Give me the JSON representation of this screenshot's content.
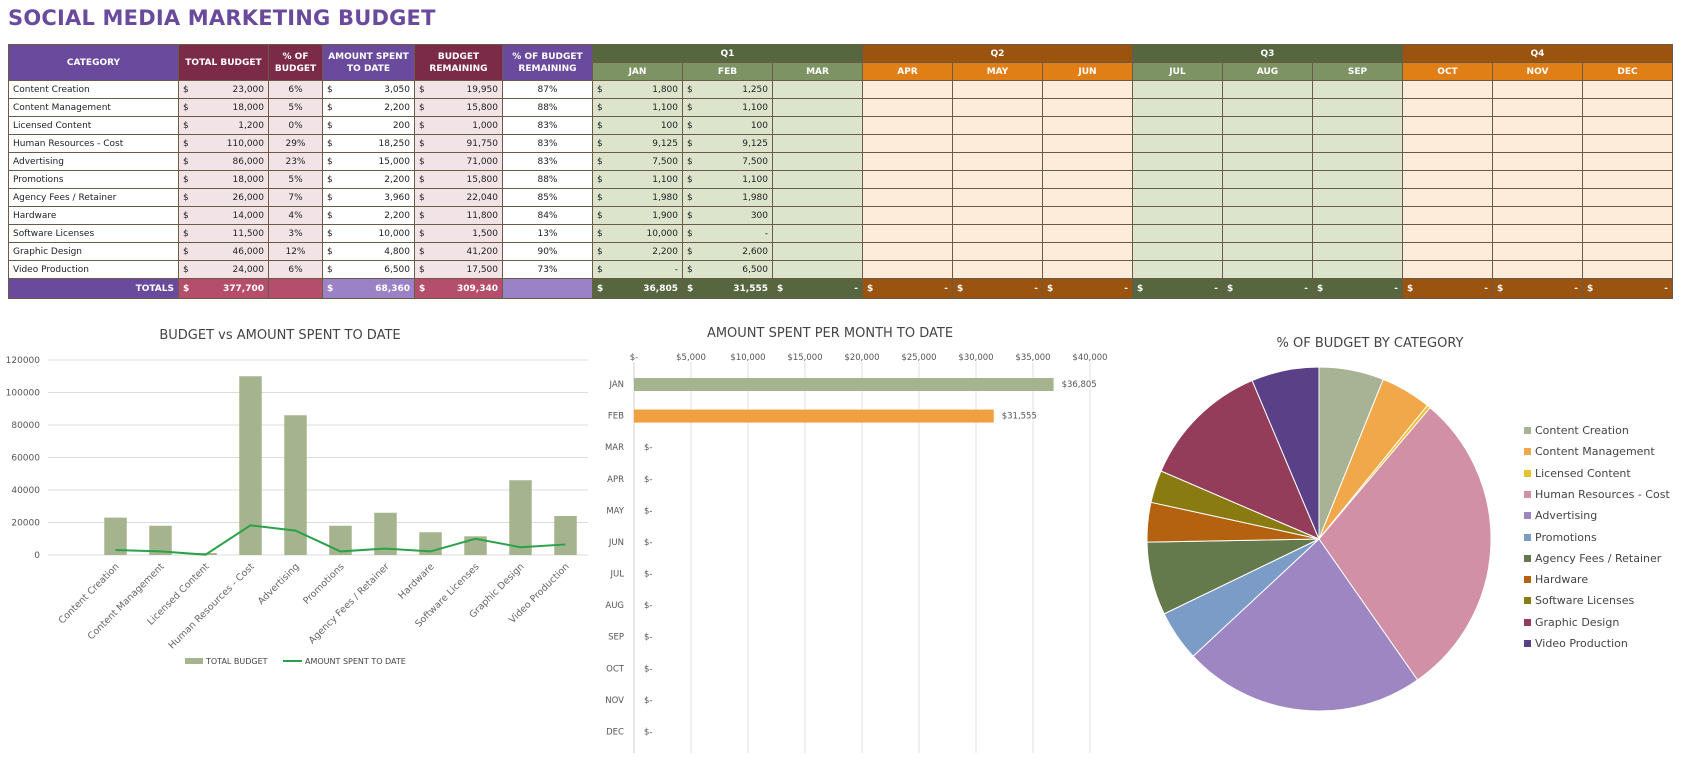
{
  "title": "SOCIAL MEDIA MARKETING BUDGET",
  "table": {
    "headers": {
      "category": "CATEGORY",
      "total_budget": "TOTAL BUDGET",
      "pct_budget_1": "% OF",
      "pct_budget_2": "BUDGET",
      "spent_1": "AMOUNT SPENT",
      "spent_2": "TO DATE",
      "remaining_1": "BUDGET",
      "remaining_2": "REMAINING",
      "pct_remaining_1": "% OF BUDGET",
      "pct_remaining_2": "REMAINING"
    },
    "quarters": [
      "Q1",
      "Q2",
      "Q3",
      "Q4"
    ],
    "months": [
      "JAN",
      "FEB",
      "MAR",
      "APR",
      "MAY",
      "JUN",
      "JUL",
      "AUG",
      "SEP",
      "OCT",
      "NOV",
      "DEC"
    ],
    "currency": "$",
    "rows": [
      {
        "category": "Content Creation",
        "total": "23,000",
        "pct": "6%",
        "spent": "3,050",
        "remaining": "19,950",
        "pct_remaining": "87%",
        "months": [
          "1,800",
          "1,250"
        ]
      },
      {
        "category": "Content Management",
        "total": "18,000",
        "pct": "5%",
        "spent": "2,200",
        "remaining": "15,800",
        "pct_remaining": "88%",
        "months": [
          "1,100",
          "1,100"
        ]
      },
      {
        "category": "Licensed Content",
        "total": "1,200",
        "pct": "0%",
        "spent": "200",
        "remaining": "1,000",
        "pct_remaining": "83%",
        "months": [
          "100",
          "100"
        ]
      },
      {
        "category": "Human Resources - Cost",
        "total": "110,000",
        "pct": "29%",
        "spent": "18,250",
        "remaining": "91,750",
        "pct_remaining": "83%",
        "months": [
          "9,125",
          "9,125"
        ]
      },
      {
        "category": "Advertising",
        "total": "86,000",
        "pct": "23%",
        "spent": "15,000",
        "remaining": "71,000",
        "pct_remaining": "83%",
        "months": [
          "7,500",
          "7,500"
        ]
      },
      {
        "category": "Promotions",
        "total": "18,000",
        "pct": "5%",
        "spent": "2,200",
        "remaining": "15,800",
        "pct_remaining": "88%",
        "months": [
          "1,100",
          "1,100"
        ]
      },
      {
        "category": "Agency Fees / Retainer",
        "total": "26,000",
        "pct": "7%",
        "spent": "3,960",
        "remaining": "22,040",
        "pct_remaining": "85%",
        "months": [
          "1,980",
          "1,980"
        ]
      },
      {
        "category": "Hardware",
        "total": "14,000",
        "pct": "4%",
        "spent": "2,200",
        "remaining": "11,800",
        "pct_remaining": "84%",
        "months": [
          "1,900",
          "300"
        ]
      },
      {
        "category": "Software Licenses",
        "total": "11,500",
        "pct": "3%",
        "spent": "10,000",
        "remaining": "1,500",
        "pct_remaining": "13%",
        "months": [
          "10,000",
          "-"
        ]
      },
      {
        "category": "Graphic Design",
        "total": "46,000",
        "pct": "12%",
        "spent": "4,800",
        "remaining": "41,200",
        "pct_remaining": "90%",
        "months": [
          "2,200",
          "2,600"
        ]
      },
      {
        "category": "Video Production",
        "total": "24,000",
        "pct": "6%",
        "spent": "6,500",
        "remaining": "17,500",
        "pct_remaining": "73%",
        "months": [
          "-",
          "6,500"
        ]
      }
    ],
    "totals": {
      "label": "TOTALS",
      "total": "377,700",
      "spent": "68,360",
      "remaining": "309,340",
      "months": [
        "36,805",
        "31,555",
        "-",
        "-",
        "-",
        "-",
        "-",
        "-",
        "-",
        "-",
        "-",
        "-"
      ]
    }
  },
  "colors": {
    "title": "#6a4a9c",
    "header_purple": "#6a4a9c",
    "header_maroon": "#7b2a48",
    "q_green": "#56663f",
    "q_orange": "#9a5410",
    "bar_budget": "#a5b48e",
    "line_spent": "#2aa24a"
  },
  "chart_data": [
    {
      "type": "bar",
      "title": "BUDGET vs AMOUNT SPENT TO DATE",
      "categories": [
        "Content Creation",
        "Content Management",
        "Licensed Content",
        "Human Resources - Cost",
        "Advertising",
        "Promotions",
        "Agency Fees / Retainer",
        "Hardware",
        "Software Licenses",
        "Graphic Design",
        "Video Production"
      ],
      "series": [
        {
          "name": "TOTAL BUDGET",
          "kind": "bar",
          "color": "#a5b48e",
          "values": [
            23000,
            18000,
            1200,
            110000,
            86000,
            18000,
            26000,
            14000,
            11500,
            46000,
            24000
          ]
        },
        {
          "name": "AMOUNT SPENT TO DATE",
          "kind": "line",
          "color": "#2aa24a",
          "values": [
            3050,
            2200,
            200,
            18250,
            15000,
            2200,
            3960,
            2200,
            10000,
            4800,
            6500
          ]
        }
      ],
      "yticks": [
        "0",
        "20000",
        "40000",
        "60000",
        "80000",
        "100000",
        "120000"
      ],
      "ylim": [
        0,
        120000
      ],
      "grid": true,
      "legend": "bottom"
    },
    {
      "type": "bar",
      "orientation": "horizontal",
      "title": "AMOUNT SPENT PER MONTH TO DATE",
      "categories": [
        "JAN",
        "FEB",
        "MAR",
        "APR",
        "MAY",
        "JUN",
        "JUL",
        "AUG",
        "SEP",
        "OCT",
        "NOV",
        "DEC"
      ],
      "values": [
        36805,
        31555,
        0,
        0,
        0,
        0,
        0,
        0,
        0,
        0,
        0,
        0
      ],
      "data_labels": [
        "$36,805",
        "$31,555",
        "$-",
        "$-",
        "$-",
        "$-",
        "$-",
        "$-",
        "$-",
        "$-",
        "$-",
        "$-"
      ],
      "bar_colors": [
        "#a5b48e",
        "#f0a040"
      ],
      "xticks": [
        "$-",
        "$5,000",
        "$10,000",
        "$15,000",
        "$20,000",
        "$25,000",
        "$30,000",
        "$35,000",
        "$40,000"
      ],
      "xlim": [
        0,
        40000
      ],
      "grid": true
    },
    {
      "type": "pie",
      "title": "% OF BUDGET BY CATEGORY",
      "labels": [
        "Content Creation",
        "Content Management",
        "Licensed Content",
        "Human Resources - Cost",
        "Advertising",
        "Promotions",
        "Agency Fees / Retainer",
        "Hardware",
        "Software Licenses",
        "Graphic Design",
        "Video Production"
      ],
      "values": [
        23000,
        18000,
        1200,
        110000,
        86000,
        18000,
        26000,
        14000,
        11500,
        46000,
        24000
      ],
      "colors": [
        "#a7b394",
        "#f0a84a",
        "#e8c12c",
        "#d290a6",
        "#9d86c2",
        "#7b9cc6",
        "#647a4c",
        "#b4620f",
        "#8a7a12",
        "#933d5a",
        "#5a4086"
      ],
      "legend": "right"
    }
  ]
}
